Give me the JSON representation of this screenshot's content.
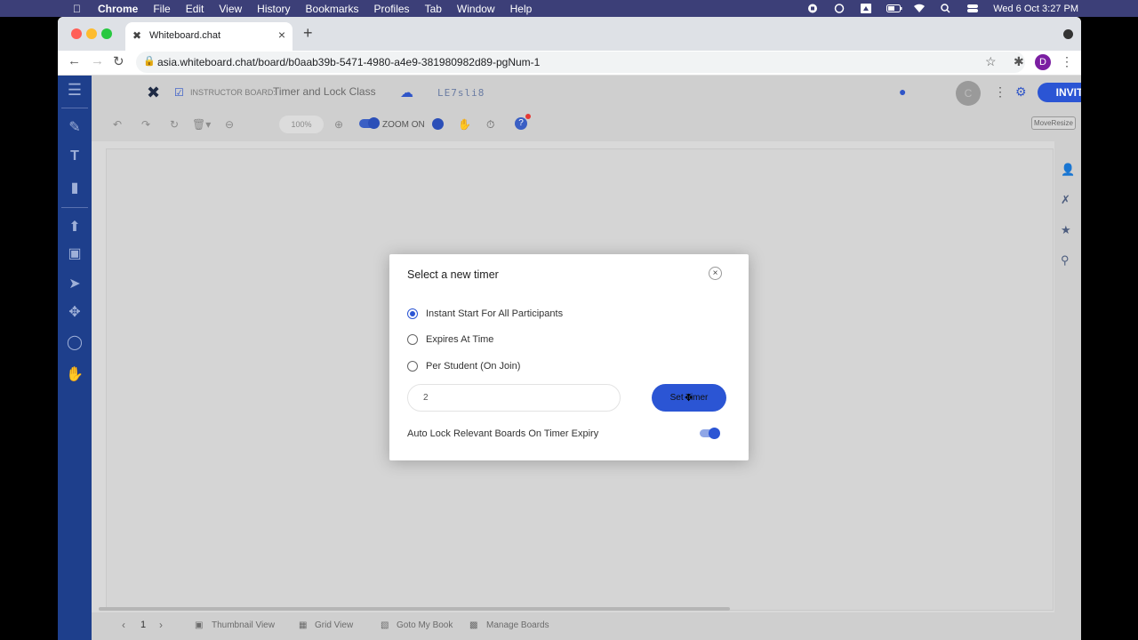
{
  "menubar": {
    "app": "Chrome",
    "items": [
      "File",
      "Edit",
      "View",
      "History",
      "Bookmarks",
      "Profiles",
      "Tab",
      "Window",
      "Help"
    ],
    "clock": "Wed 6 Oct  3:27 PM"
  },
  "browser": {
    "tab_title": "Whiteboard.chat",
    "url": "asia.whiteboard.chat/board/b0aab39b-5471-4980-a4e9-381980982d89-pgNum-1",
    "profile_initial": "D"
  },
  "app": {
    "board_prefix": "INSTRUCTOR BOARD:",
    "board_name": "Timer and Lock Class",
    "board_code": "LE7sli8",
    "user_initial": "C",
    "invite_label": "INVITE",
    "zoom_value": "100%",
    "zoom_label": "ZOOM ON",
    "move_resize_label": "MoveResize",
    "page_number": "1",
    "bottom_items": [
      "Thumbnail View",
      "Grid View",
      "Goto My Book",
      "Manage Boards"
    ]
  },
  "dialog": {
    "title": "Select a new timer",
    "options": [
      {
        "label": "Instant Start For All Participants",
        "selected": true
      },
      {
        "label": "Expires At Time",
        "selected": false
      },
      {
        "label": "Per Student (On Join)",
        "selected": false
      }
    ],
    "timer_value": "2",
    "set_button_label": "Set Timer",
    "auto_lock_label": "Auto Lock Relevant Boards On Timer Expiry",
    "auto_lock_on": true
  },
  "colors": {
    "accent": "#2b55d4",
    "sidebar": "#1e3f8c",
    "menubar": "#3c3f78"
  }
}
